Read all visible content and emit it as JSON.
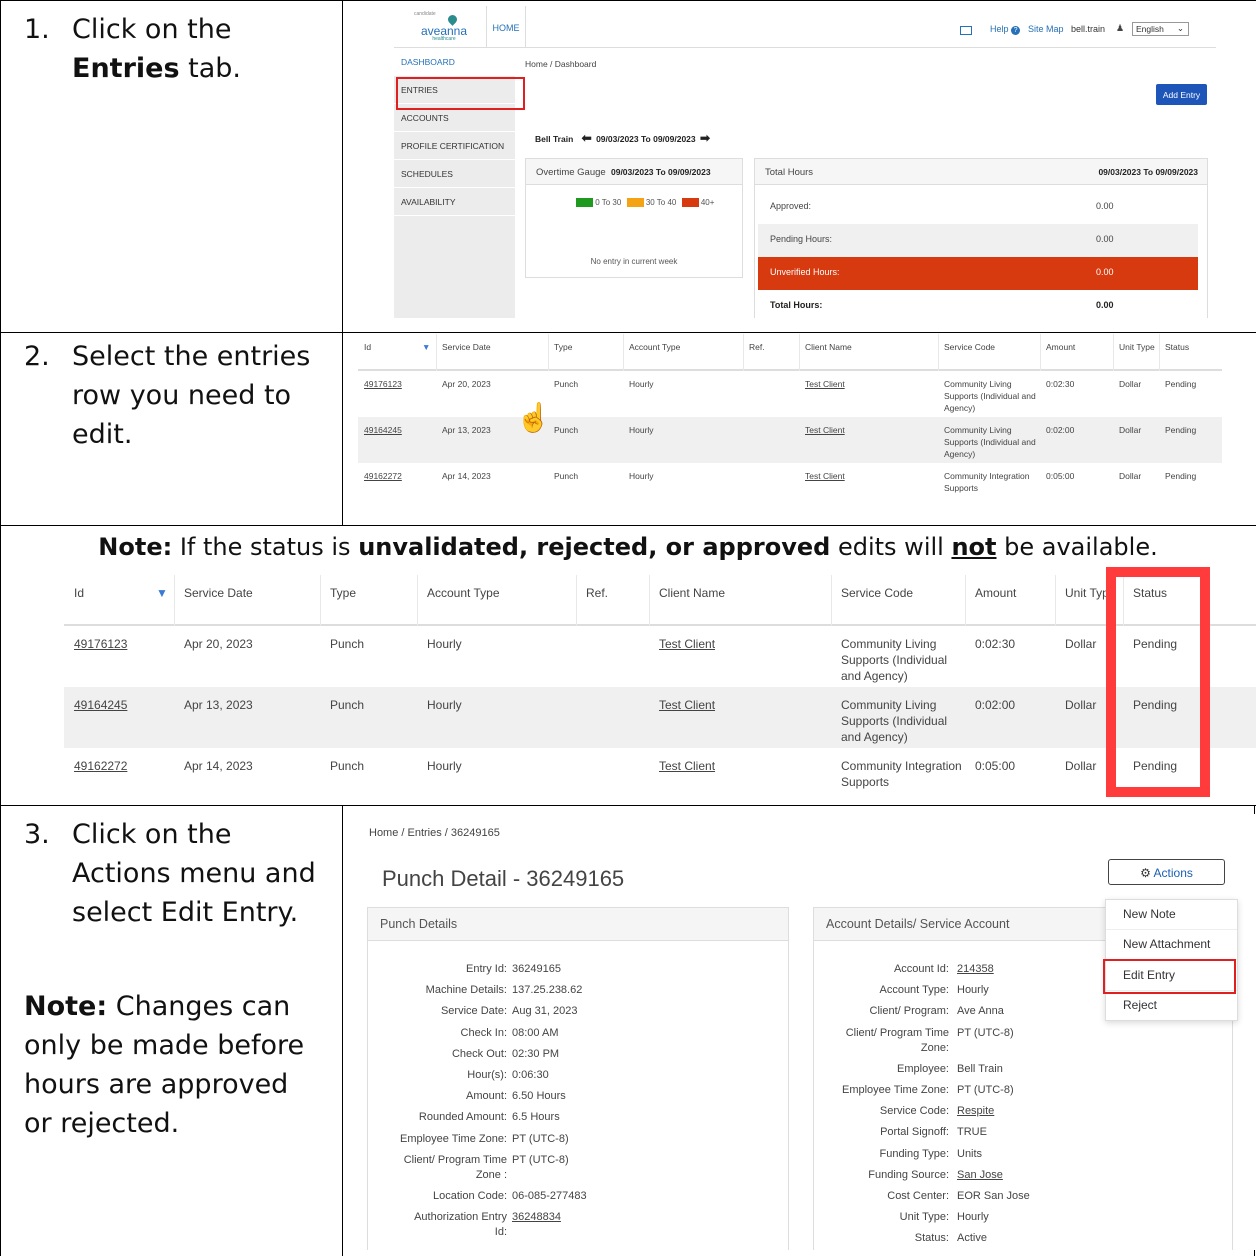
{
  "steps": [
    {
      "num": "1.",
      "pre": "Click on the ",
      "bold": "Entries",
      "post": " tab."
    },
    {
      "num": "2.",
      "text": "Select the entries row you need to edit."
    },
    {
      "num": "3.",
      "text": "Click on the Actions menu and select Edit Entry."
    }
  ],
  "note_status": {
    "label": "Note:",
    "t1": " If the status is ",
    "b1": "unvalidated, rejected, or approved",
    "t2": " edits will ",
    "b2": "not",
    "t3": " be available."
  },
  "note_changes": {
    "label": "Note:",
    "text": " Changes can only be made before hours are approved or rejected."
  },
  "dashboard": {
    "logo_top": "candidate",
    "logo_main": "aveanna",
    "logo_sub": "healthcare",
    "home_tab": "HOME",
    "help": "Help",
    "sitemap": "Site Map",
    "user": "bell.train",
    "language": "English",
    "sidebar": [
      "DASHBOARD",
      "ENTRIES",
      "ACCOUNTS",
      "PROFILE CERTIFICATION",
      "SCHEDULES",
      "AVAILABILITY"
    ],
    "breadcrumb": "Home / Dashboard",
    "add_entry": "Add Entry",
    "employee": "Bell Train",
    "week_range": "09/03/2023 To 09/09/2023",
    "gauge_title": "Overtime Gauge",
    "gauge_range": "09/03/2023 To 09/09/2023",
    "legend": [
      "0 To 30",
      "30 To 40",
      "40+"
    ],
    "legend_colors": [
      "#1f9a1f",
      "#f5a316",
      "#d83a10"
    ],
    "no_entry": "No entry in current week",
    "hours_title": "Total Hours",
    "hours_range": "09/03/2023 To 09/09/2023",
    "hours_rows": [
      {
        "label": "Approved:",
        "value": "0.00"
      },
      {
        "label": "Pending Hours:",
        "value": "0.00"
      },
      {
        "label": "Unverified Hours:",
        "value": "0.00"
      },
      {
        "label": "Total Hours:",
        "value": "0.00"
      }
    ]
  },
  "entries_table": {
    "headers": [
      "Id",
      "Service Date",
      "Type",
      "Account Type",
      "Ref.",
      "Client Name",
      "Service Code",
      "Amount",
      "Unit Type",
      "Status"
    ],
    "rows": [
      {
        "id": "49176123",
        "date": "Apr 20, 2023",
        "type": "Punch",
        "account": "Hourly",
        "ref": "",
        "client": "Test Client",
        "code": "Community Living Supports (Individual and Agency)",
        "amount": "0:02:30",
        "unit": "Dollar",
        "status": "Pending"
      },
      {
        "id": "49164245",
        "date": "Apr 13, 2023",
        "type": "Punch",
        "account": "Hourly",
        "ref": "",
        "client": "Test Client",
        "code": "Community Living Supports (Individual and Agency)",
        "amount": "0:02:00",
        "unit": "Dollar",
        "status": "Pending"
      },
      {
        "id": "49162272",
        "date": "Apr 14, 2023",
        "type": "Punch",
        "account": "Hourly",
        "ref": "",
        "client": "Test Client",
        "code": "Community Integration Supports",
        "amount": "0:05:00",
        "unit": "Dollar",
        "status": "Pending"
      }
    ]
  },
  "punch": {
    "breadcrumb": "Home / Entries / 36249165",
    "title": "Punch Detail - 36249165",
    "actions": "Actions",
    "menu": [
      "New Note",
      "New Attachment",
      "Edit Entry",
      "Reject"
    ],
    "left_title": "Punch Details",
    "right_title": "Account Details/ Service Account",
    "left": [
      {
        "k": "Entry Id:",
        "v": "36249165"
      },
      {
        "k": "Machine Details:",
        "v": "137.25.238.62"
      },
      {
        "k": "Service Date:",
        "v": "Aug 31, 2023"
      },
      {
        "k": "Check In:",
        "v": "08:00 AM"
      },
      {
        "k": "Check Out:",
        "v": "02:30 PM"
      },
      {
        "k": "Hour(s):",
        "v": "0:06:30"
      },
      {
        "k": "Amount:",
        "v": "6.50 Hours"
      },
      {
        "k": "Rounded Amount:",
        "v": "6.5 Hours"
      },
      {
        "k": "Employee Time Zone:",
        "v": "PT (UTC-8)"
      },
      {
        "k": "Client/ Program Time",
        "k2": "Zone :",
        "v": "PT (UTC-8)"
      },
      {
        "k": "Location Code:",
        "v": "06-085-277483"
      },
      {
        "k": "Authorization Entry",
        "k2": "Id:",
        "v": "36248834",
        "link": true
      }
    ],
    "right": [
      {
        "k": "Account Id:",
        "v": "214358",
        "link": true
      },
      {
        "k": "Account Type:",
        "v": "Hourly"
      },
      {
        "k": "Client/ Program:",
        "v": "Ave Anna"
      },
      {
        "k": "Client/ Program Time",
        "k2": "Zone:",
        "v": "PT (UTC-8)"
      },
      {
        "k": "Employee:",
        "v": "Bell Train"
      },
      {
        "k": "Employee Time Zone:",
        "v": "PT (UTC-8)"
      },
      {
        "k": "Service Code:",
        "v": "Respite",
        "link": true
      },
      {
        "k": "Portal Signoff:",
        "v": "TRUE"
      },
      {
        "k": "Funding Type:",
        "v": "Units"
      },
      {
        "k": "Funding Source:",
        "v": "San Jose",
        "link": true
      },
      {
        "k": "Cost Center:",
        "v": "EOR San Jose"
      },
      {
        "k": "Unit Type:",
        "v": "Hourly"
      },
      {
        "k": "Status:",
        "v": "Active"
      }
    ]
  },
  "colors": {
    "highlight_red": "#e02020",
    "link": "#1a5fb4",
    "add_entry": "#1d56b8",
    "unverified": "#d83a10"
  }
}
